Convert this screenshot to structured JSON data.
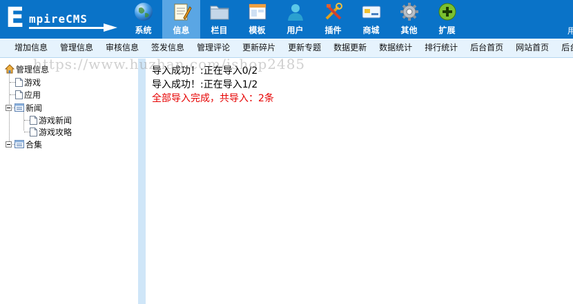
{
  "logo": {
    "first_letter": "E",
    "rest": "mpireCMS"
  },
  "top_nav": [
    {
      "label": "系统",
      "icon": "globe-icon"
    },
    {
      "label": "信息",
      "icon": "notepad-icon",
      "active": true
    },
    {
      "label": "栏目",
      "icon": "folder-icon"
    },
    {
      "label": "模板",
      "icon": "window-icon"
    },
    {
      "label": "用户",
      "icon": "user-icon"
    },
    {
      "label": "插件",
      "icon": "tools-icon"
    },
    {
      "label": "商城",
      "icon": "card-icon"
    },
    {
      "label": "其他",
      "icon": "gear-icon"
    },
    {
      "label": "扩展",
      "icon": "plus-icon"
    }
  ],
  "header_right": "用",
  "sub_nav": [
    "增加信息",
    "管理信息",
    "审核信息",
    "签发信息",
    "管理评论",
    "更新碎片",
    "更新专题",
    "数据更新",
    "数据统计",
    "排行统计",
    "后台首页",
    "网站首页",
    "后台"
  ],
  "tree": {
    "root": "管理信息",
    "nodes": {
      "youxi": "游戏",
      "yingyong": "应用",
      "xinwen": "新闻",
      "youxixinwen": "游戏新闻",
      "youxigonglue": "游戏攻略",
      "heji": "合集"
    }
  },
  "main": {
    "messages": [
      "导入成功！:正在导入0/2",
      "导入成功！:正在导入1/2"
    ],
    "done": "全部导入完成，共导入：2条"
  },
  "watermark": "https://www.huzhan.com/ishop2485",
  "colors": {
    "header": "#0a73c8",
    "active_tab": "#5aa6e4",
    "subnav": "#e6f3fd",
    "splitter": "#cfe6f8",
    "done_text": "#e60000"
  }
}
